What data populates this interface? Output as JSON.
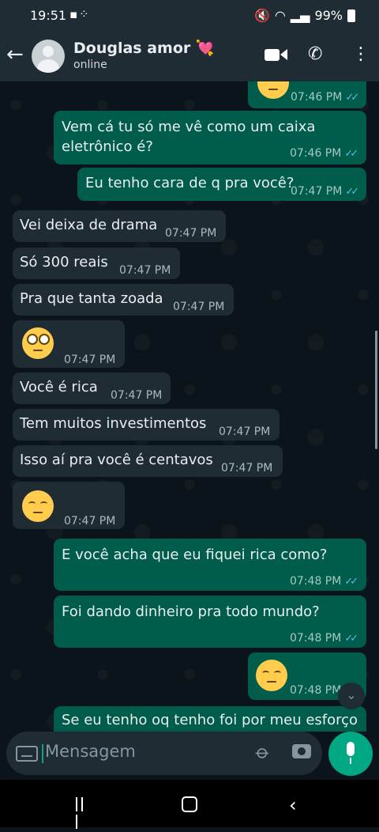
{
  "status_bar": {
    "time": "19:51",
    "battery": "99%"
  },
  "header": {
    "name": "Douglas amor 💘",
    "status": "online"
  },
  "messages": [
    {
      "dir": "out",
      "kind": "emoji",
      "emoji": "😒",
      "time": "07:46 PM"
    },
    {
      "dir": "out",
      "line1": "Vem cá tu só me vê como um caixa",
      "line2": "eletrônico é?",
      "time": "07:46 PM"
    },
    {
      "dir": "out",
      "text": "Eu tenho cara de q pra você?",
      "time": "07:47 PM"
    },
    {
      "dir": "in",
      "text": "Vei deixa de drama",
      "time": "07:47 PM"
    },
    {
      "dir": "in",
      "text": "Só 300 reais",
      "time": "07:47 PM"
    },
    {
      "dir": "in",
      "text": "Pra que tanta zoada",
      "time": "07:47 PM"
    },
    {
      "dir": "in",
      "kind": "emoji",
      "emoji": "🙄",
      "time": "07:47 PM"
    },
    {
      "dir": "in",
      "text": "Você é rica",
      "time": "07:47 PM"
    },
    {
      "dir": "in",
      "text": "Tem muitos investimentos",
      "time": "07:47 PM"
    },
    {
      "dir": "in",
      "text": "Isso aí pra você é centavos",
      "time": "07:47 PM"
    },
    {
      "dir": "in",
      "kind": "emoji",
      "emoji": "😒",
      "time": "07:47 PM"
    },
    {
      "dir": "out",
      "text": "E você acha que eu fiquei rica como?",
      "time": "07:48 PM"
    },
    {
      "dir": "out",
      "text": "Foi dando dinheiro pra todo mundo?",
      "time": "07:48 PM"
    },
    {
      "dir": "out",
      "kind": "emoji",
      "emoji": "😒",
      "time": "07:48 PM"
    },
    {
      "dir": "out",
      "text": "Se eu tenho oq tenho foi por meu esforço",
      "time": ""
    }
  ],
  "input": {
    "placeholder": "Mensagem"
  }
}
